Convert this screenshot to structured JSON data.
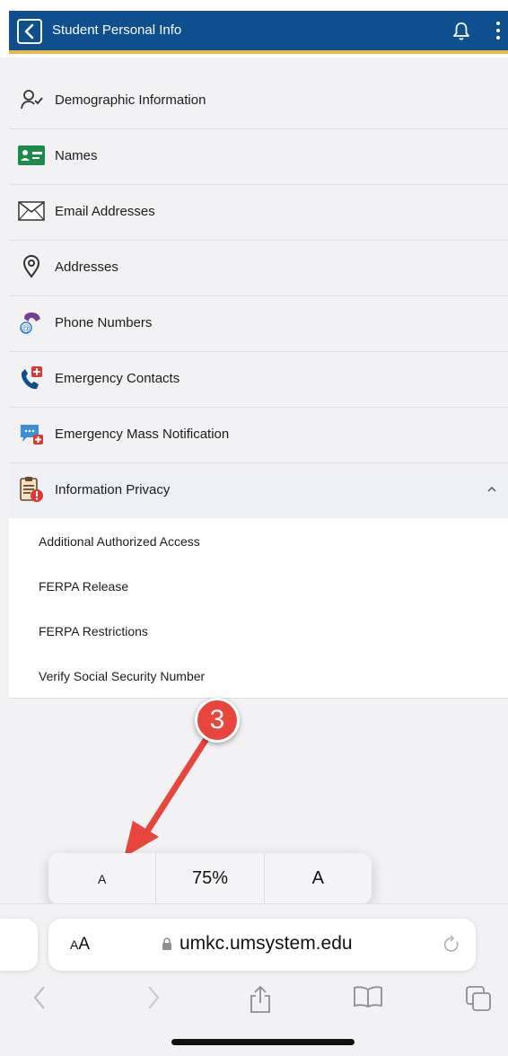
{
  "header": {
    "title": "Student Personal Info",
    "colors": {
      "bar": "#0e4f8f",
      "accent": "#e9b949"
    }
  },
  "menu": {
    "items": [
      {
        "label": "Demographic Information",
        "icon": "person-check-icon"
      },
      {
        "label": "Names",
        "icon": "id-card-icon"
      },
      {
        "label": "Email Addresses",
        "icon": "envelope-icon"
      },
      {
        "label": "Addresses",
        "icon": "location-pin-icon"
      },
      {
        "label": "Phone Numbers",
        "icon": "phone-at-icon"
      },
      {
        "label": "Emergency Contacts",
        "icon": "emergency-phone-icon"
      },
      {
        "label": "Emergency Mass Notification",
        "icon": "chat-alert-icon"
      },
      {
        "label": "Information Privacy",
        "icon": "clipboard-alert-icon",
        "expanded": true
      }
    ]
  },
  "submenu": {
    "items": [
      {
        "label": "Additional Authorized Access"
      },
      {
        "label": "FERPA Release"
      },
      {
        "label": "FERPA Restrictions"
      },
      {
        "label": "Verify Social Security Number"
      }
    ]
  },
  "annotation": {
    "step": "3",
    "color": "#e8463d"
  },
  "zoom": {
    "smaller": "A",
    "value": "75%",
    "larger": "A"
  },
  "browser": {
    "aa_small": "A",
    "aa_large": "A",
    "url": "umkc.umsystem.edu"
  }
}
